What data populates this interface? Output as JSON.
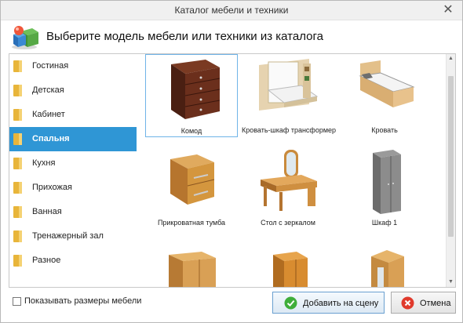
{
  "window": {
    "title": "Каталог мебели и техники",
    "close_glyph": "✕"
  },
  "header": {
    "title": "Выберите модель мебели или техники из каталога",
    "logo_icon": "furniture-catalog-logo-icon"
  },
  "sidebar": {
    "items": [
      {
        "label": "Гостиная",
        "icon": "folder-icon",
        "active": false
      },
      {
        "label": "Детская",
        "icon": "folder-icon",
        "active": false
      },
      {
        "label": "Кабинет",
        "icon": "folder-icon",
        "active": false
      },
      {
        "label": "Спальня",
        "icon": "folder-icon",
        "active": true
      },
      {
        "label": "Кухня",
        "icon": "folder-icon",
        "active": false
      },
      {
        "label": "Прихожая",
        "icon": "folder-icon",
        "active": false
      },
      {
        "label": "Ванная",
        "icon": "folder-icon",
        "active": false
      },
      {
        "label": "Тренажерный зал",
        "icon": "folder-icon",
        "active": false
      },
      {
        "label": "Разное",
        "icon": "folder-icon",
        "active": false
      }
    ]
  },
  "catalog": {
    "items": [
      {
        "label": "Комод",
        "icon": "chest-of-drawers-icon",
        "selected": true
      },
      {
        "label": "Кровать-шкаф трансформер",
        "icon": "wall-bed-icon",
        "selected": false
      },
      {
        "label": "Кровать",
        "icon": "bed-icon",
        "selected": false
      },
      {
        "label": "Прикроватная тумба",
        "icon": "nightstand-icon",
        "selected": false
      },
      {
        "label": "Стол с зеркалом",
        "icon": "dressing-table-icon",
        "selected": false
      },
      {
        "label": "Шкаф 1",
        "icon": "wardrobe-icon",
        "selected": false
      },
      {
        "label": "",
        "icon": "wardrobe-2-icon",
        "selected": false
      },
      {
        "label": "",
        "icon": "wardrobe-3-icon",
        "selected": false
      },
      {
        "label": "",
        "icon": "corner-wardrobe-icon",
        "selected": false
      }
    ]
  },
  "footer": {
    "show_sizes_label": "Показывать размеры мебели",
    "show_sizes_checked": false,
    "add_button_label": "Добавить на сцену",
    "cancel_button_label": "Отмена"
  },
  "colors": {
    "accent": "#2f96d5",
    "folder": "#e8b53a",
    "wood_dark": "#5a2a1a",
    "wood_light": "#d9a35a"
  }
}
